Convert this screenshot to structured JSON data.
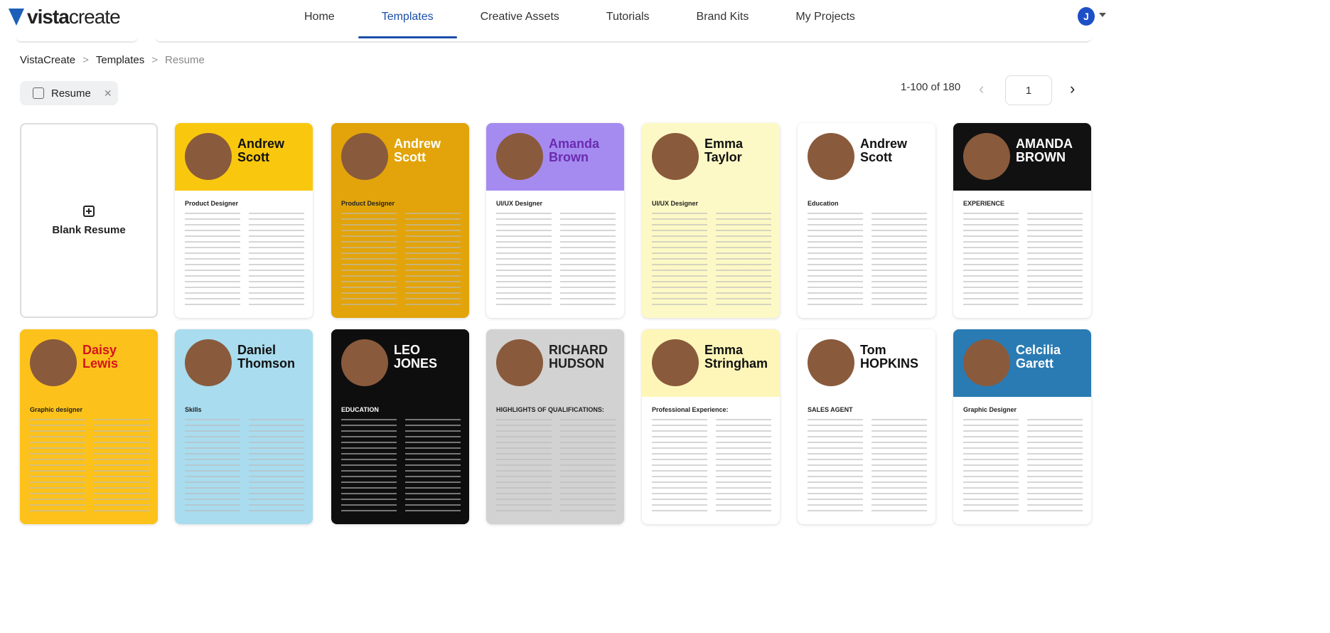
{
  "header": {
    "logo": {
      "bold": "vista",
      "light": "create"
    },
    "nav": [
      "Home",
      "Templates",
      "Creative Assets",
      "Tutorials",
      "Brand Kits",
      "My Projects"
    ],
    "active_nav": "Templates",
    "user_initial": "J"
  },
  "breadcrumb": [
    "VistaCreate",
    "Templates",
    "Resume"
  ],
  "filter_chip": {
    "label": "Resume",
    "icon": "template-icon"
  },
  "pagination": {
    "range": "1-100 of 180",
    "page": "1"
  },
  "colors": {
    "accent": "#1b4fa8",
    "avatar": "#1d4fc7"
  },
  "blank": {
    "label": "Blank Resume"
  },
  "templates": [
    {
      "title": "Andrew Scott",
      "subtitle": "Product Designer",
      "bg": "#ffffff",
      "band": "#f9c80e",
      "fg": "#111"
    },
    {
      "title": "Andrew Scott",
      "subtitle": "Product Designer",
      "bg": "#e2a40a",
      "band": "#e2a40a",
      "fg": "#fff"
    },
    {
      "title": "Amanda Brown",
      "subtitle": "UI/UX Designer",
      "bg": "#ffffff",
      "band": "#a58bf0",
      "fg": "#6a2bb0"
    },
    {
      "title": "Emma Taylor",
      "subtitle": "UI/UX Designer",
      "bg": "#fdf9c6",
      "band": "#fdf9c6",
      "fg": "#111"
    },
    {
      "title": "Andrew Scott",
      "subtitle": "Education",
      "bg": "#ffffff",
      "band": "#ffffff",
      "fg": "#111"
    },
    {
      "title": "AMANDA BROWN",
      "subtitle": "EXPERIENCE",
      "bg": "#ffffff",
      "band": "#111111",
      "fg": "#fff"
    },
    {
      "title": "Daisy Lewis",
      "subtitle": "Graphic designer",
      "bg": "#fcc21b",
      "band": "#fcc21b",
      "fg": "#d4141c"
    },
    {
      "title": "Daniel Thomson",
      "subtitle": "Skills",
      "bg": "#a9dcee",
      "band": "#a9dcee",
      "fg": "#111"
    },
    {
      "title": "LEO JONES",
      "subtitle": "EDUCATION",
      "bg": "#0e0e0e",
      "band": "#0e0e0e",
      "fg": "#fff"
    },
    {
      "title": "RICHARD HUDSON",
      "subtitle": "HIGHLIGHTS OF QUALIFICATIONS:",
      "bg": "#d2d2d2",
      "band": "#d2d2d2",
      "fg": "#222"
    },
    {
      "title": "Emma Stringham",
      "subtitle": "Professional Experience:",
      "bg": "#ffffff",
      "band": "#fdf6b8",
      "fg": "#111"
    },
    {
      "title": "Tom HOPKINS",
      "subtitle": "SALES AGENT",
      "bg": "#ffffff",
      "band": "#ffffff",
      "fg": "#111"
    },
    {
      "title": "Celcilia Garett",
      "subtitle": "Graphic Designer",
      "bg": "#ffffff",
      "band": "#2a7bb3",
      "fg": "#fff"
    }
  ]
}
